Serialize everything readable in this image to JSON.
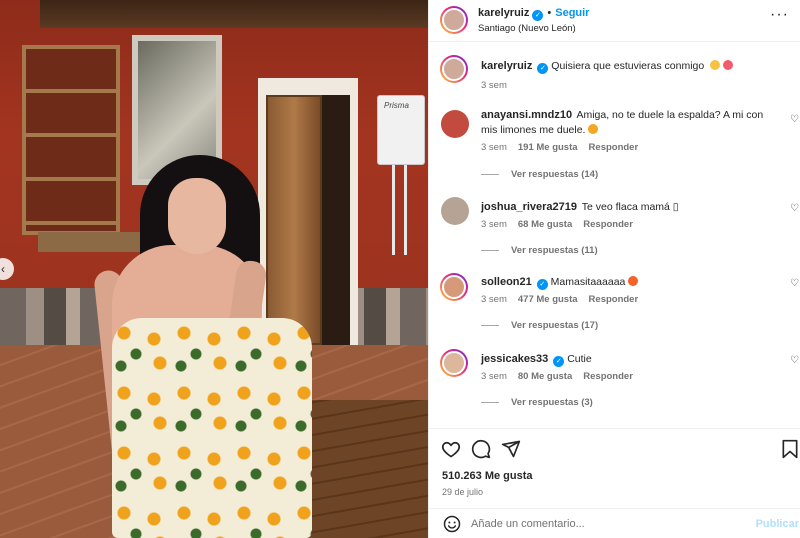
{
  "post_header": {
    "username": "karelyruiz",
    "follow_label": "Seguir",
    "separator": "•",
    "location": "Santiago (Nuevo León)",
    "more_label": "···"
  },
  "caption": {
    "username": "karelyruiz",
    "text": "Quisiera que estuvieras conmigo",
    "time": "3 sem"
  },
  "comments": [
    {
      "username": "anayansi.mndz10",
      "text": "Amiga, no te duele la espalda? A mi con mis limones me duele.",
      "time": "3 sem",
      "likes": "191 Me gusta",
      "reply_label": "Responder",
      "replies": "Ver respuestas (14)"
    },
    {
      "username": "joshua_rivera2719",
      "text": "Te veo flaca mamá ▯",
      "time": "3 sem",
      "likes": "68 Me gusta",
      "reply_label": "Responder",
      "replies": "Ver respuestas (11)"
    },
    {
      "username": "solleon21",
      "text": "Mamasitaaaaaa",
      "time": "3 sem",
      "likes": "477 Me gusta",
      "reply_label": "Responder",
      "replies": "Ver respuestas (17)"
    },
    {
      "username": "jessicakes33",
      "text": "Cutie",
      "time": "3 sem",
      "likes": "80 Me gusta",
      "reply_label": "Responder",
      "replies": "Ver respuestas (3)"
    }
  ],
  "post_stats": {
    "likes": "510.263 Me gusta",
    "date": "29 de julio"
  },
  "composer": {
    "placeholder": "Añade un comentario...",
    "post_label": "Publicar"
  },
  "photo": {
    "heater_brand": "Prisma"
  },
  "colors": {
    "accent": "#0095f6",
    "text": "#262626",
    "muted": "#737373"
  },
  "icons": [
    "heart-icon",
    "comment-icon",
    "share-icon",
    "bookmark-icon",
    "emoji-icon",
    "more-icon",
    "verified-badge-icon",
    "carousel-prev-icon"
  ]
}
